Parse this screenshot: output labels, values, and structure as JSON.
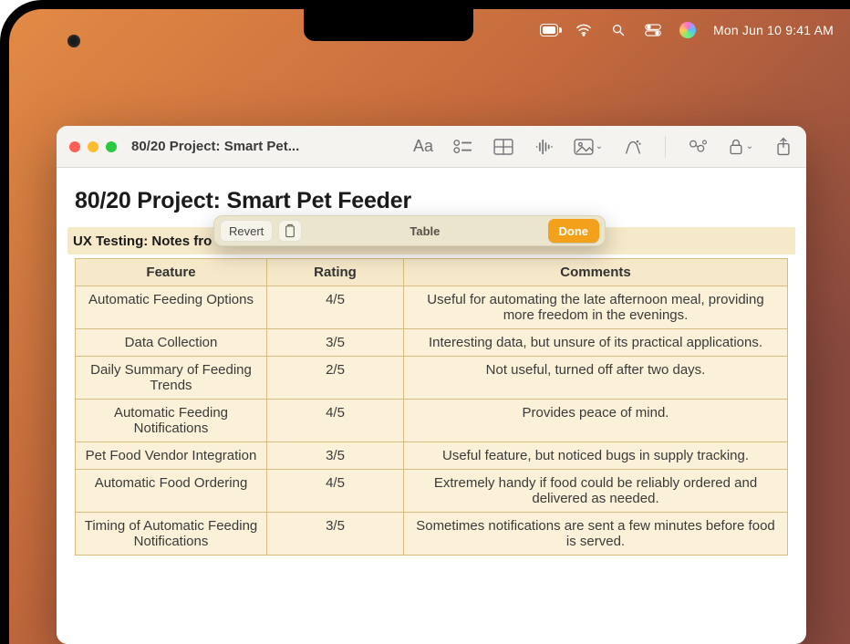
{
  "menubar": {
    "datetime": "Mon Jun 10  9:41 AM"
  },
  "window": {
    "title": "80/20 Project: Smart Pet..."
  },
  "document": {
    "title": "80/20 Project: Smart Pet Feeder",
    "subheading": "UX Testing: Notes fro"
  },
  "float_toolbar": {
    "revert_label": "Revert",
    "title": "Table",
    "done_label": "Done"
  },
  "table": {
    "headers": {
      "feature": "Feature",
      "rating": "Rating",
      "comments": "Comments"
    },
    "rows": [
      {
        "feature": "Automatic Feeding Options",
        "rating": "4/5",
        "comments": "Useful for automating the late afternoon meal, providing more freedom in the evenings."
      },
      {
        "feature": "Data Collection",
        "rating": "3/5",
        "comments": "Interesting data, but unsure of its practical applications."
      },
      {
        "feature": "Daily Summary of Feeding Trends",
        "rating": "2/5",
        "comments": "Not useful, turned off after two days."
      },
      {
        "feature": "Automatic Feeding Notifications",
        "rating": "4/5",
        "comments": "Provides peace of mind."
      },
      {
        "feature": "Pet Food Vendor Integration",
        "rating": "3/5",
        "comments": "Useful feature, but noticed bugs in supply tracking."
      },
      {
        "feature": "Automatic Food Ordering",
        "rating": "4/5",
        "comments": "Extremely handy if food could be reliably ordered and delivered as needed."
      },
      {
        "feature": "Timing of Automatic Feeding Notifications",
        "rating": "3/5",
        "comments": "Sometimes notifications are sent a few minutes before food is served."
      }
    ]
  }
}
